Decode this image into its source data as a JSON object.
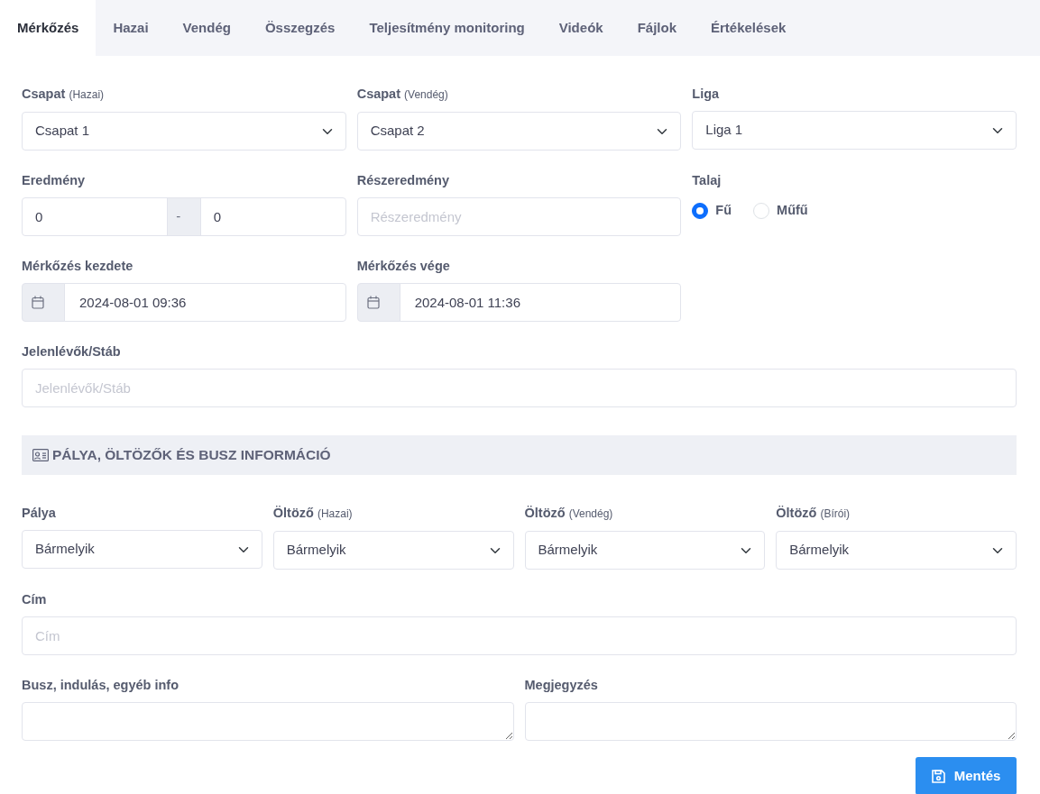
{
  "tabs": [
    {
      "label": "Mérkőzés",
      "selected": true
    },
    {
      "label": "Hazai",
      "selected": false
    },
    {
      "label": "Vendég",
      "selected": false
    },
    {
      "label": "Összegzés",
      "selected": false
    },
    {
      "label": "Teljesítmény monitoring",
      "selected": false
    },
    {
      "label": "Videók",
      "selected": false
    },
    {
      "label": "Fájlok",
      "selected": false
    },
    {
      "label": "Értékelések",
      "selected": false
    }
  ],
  "home_team": {
    "label": "Csapat",
    "sublabel": "(Hazai)",
    "value": "Csapat 1"
  },
  "away_team": {
    "label": "Csapat",
    "sublabel": "(Vendég)",
    "value": "Csapat 2"
  },
  "league": {
    "label": "Liga",
    "value": "Liga 1"
  },
  "score": {
    "label": "Eredmény",
    "home": "0",
    "separator": "-",
    "away": "0"
  },
  "half_time": {
    "label": "Részeredmény",
    "placeholder": "Részeredmény"
  },
  "surface": {
    "label": "Talaj",
    "options": [
      {
        "label": "Fű",
        "selected": true
      },
      {
        "label": "Műfű",
        "selected": false
      }
    ]
  },
  "start": {
    "label": "Mérkőzés kezdete",
    "value": "2024-08-01 09:36"
  },
  "end": {
    "label": "Mérkőzés vége",
    "value": "2024-08-01 11:36"
  },
  "staff": {
    "label": "Jelenlévők/Stáb",
    "placeholder": "Jelenlévők/Stáb"
  },
  "section": {
    "title": "PÁLYA, ÖLTÖZŐK ÉS BUSZ INFORMÁCIÓ"
  },
  "venue_selects": [
    {
      "label": "Pálya",
      "value": "Bármelyik"
    },
    {
      "label": "Öltöző",
      "sublabel": "(Hazai)",
      "value": "Bármelyik"
    },
    {
      "label": "Öltöző",
      "sublabel": "(Vendég)",
      "value": "Bármelyik"
    },
    {
      "label": "Öltöző",
      "sublabel": "(Bírói)",
      "value": "Bármelyik"
    }
  ],
  "address": {
    "label": "Cím",
    "placeholder": "Cím"
  },
  "notes": [
    {
      "label": "Busz, indulás, egyéb info"
    },
    {
      "label": "Megjegyzés"
    }
  ],
  "save_button": {
    "label": "Mentés"
  }
}
